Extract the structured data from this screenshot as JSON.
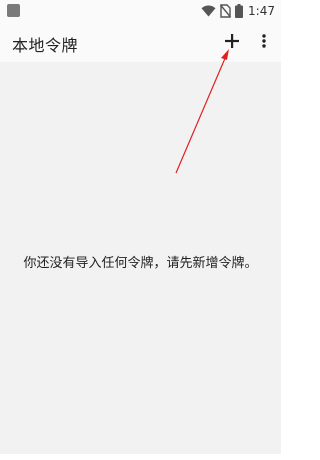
{
  "status_bar": {
    "time": "1:47",
    "icons": [
      "notification-square-icon",
      "wifi-icon",
      "no-sim-icon",
      "battery-icon"
    ]
  },
  "app_bar": {
    "title": "本地令牌",
    "add_icon": "plus-icon",
    "more_icon": "more-vert-icon"
  },
  "main": {
    "empty_message": "你还没有导入任何令牌，请先新增令牌。"
  },
  "colors": {
    "annotation_arrow": "#e02020",
    "content_background": "#f2f2f2",
    "app_bar_background": "#fafafa"
  }
}
